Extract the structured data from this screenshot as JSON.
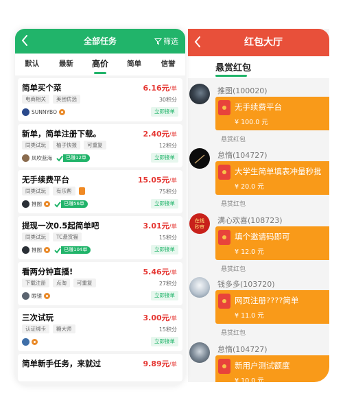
{
  "left_app": {
    "title": "全部任务",
    "filter_label": "筛选",
    "tabs": [
      {
        "label": "默认",
        "active": false
      },
      {
        "label": "最新",
        "active": false
      },
      {
        "label": "高价",
        "active": true
      },
      {
        "label": "简单",
        "active": false
      },
      {
        "label": "信誉",
        "active": false
      }
    ],
    "tasks": [
      {
        "title": "简单买个菜",
        "price": "6.16元",
        "unit": "/单",
        "tags": [
          "电商相关",
          "美团优选"
        ],
        "points": "30积分",
        "user": "SUNNYBO",
        "vip": true,
        "badge": "",
        "join_label": "立即接单"
      },
      {
        "title": "新单，简单注册下载。",
        "price": "2.40元",
        "unit": "/单",
        "tags": [
          "同类试玩",
          "柚子快报",
          "可重复"
        ],
        "points": "12积分",
        "user": "风吹蓝海",
        "vip": false,
        "badge": "已赚12单",
        "join_label": "立即接单"
      },
      {
        "title": "无手续费平台",
        "price": "15.05元",
        "unit": "/单",
        "tags": [
          "同类试玩",
          "有乐帮"
        ],
        "points": "75积分",
        "user": "推图",
        "vip": true,
        "badge": "已赚56单",
        "join_label": "立即接单"
      },
      {
        "title": "提现一次0.5起简单吧",
        "price": "3.01元",
        "unit": "/单",
        "tags": [
          "同类试玩",
          "TC悬赏猫"
        ],
        "points": "15积分",
        "user": "推图",
        "vip": true,
        "badge": "已赚104单",
        "join_label": "立即接单"
      },
      {
        "title": "看两分钟直播!",
        "price": "5.46元",
        "unit": "/单",
        "tags": [
          "下载注册",
          "点淘",
          "可重复"
        ],
        "points": "27积分",
        "user": "眼镜",
        "vip": true,
        "badge": "",
        "join_label": "立即接单"
      },
      {
        "title": "三次试玩",
        "price": "3.00元",
        "unit": "/单",
        "tags": [
          "认证绑卡",
          "糖大师"
        ],
        "points": "15积分",
        "user": "",
        "vip": true,
        "badge": "",
        "join_label": "立即接单"
      },
      {
        "title": "简单新手任务，来就过",
        "price": "9.89元",
        "unit": "/单",
        "tags": [],
        "points": "",
        "user": "",
        "vip": false,
        "badge": "",
        "join_label": ""
      }
    ]
  },
  "right_app": {
    "title": "红包大厅",
    "tab_label": "悬赏红包",
    "posts": [
      {
        "user": "推图(100020)",
        "title": "无手续费平台",
        "amount": "¥ 100.0 元",
        "tag": "悬赏红包"
      },
      {
        "user": "怠惰(104727)",
        "title": "大学生简单填表冲量秒批",
        "amount": "¥ 20.0 元",
        "tag": "悬赏红包"
      },
      {
        "user": "满心欢喜(108723)",
        "title": "填个邀请码即可",
        "amount": "¥ 12.0 元",
        "tag": "悬赏红包",
        "avatar_text": "在线\n秒审"
      },
      {
        "user": "钱多多(103720)",
        "title": "网页注册????简单",
        "amount": "¥ 11.0 元",
        "tag": "悬赏红包"
      },
      {
        "user": "怠惰(104727)",
        "title": "新用户测试额度",
        "amount": "¥ 10.0 元",
        "tag": ""
      }
    ]
  },
  "colors": {
    "green": "#21b46a",
    "red_header": "#e8503a",
    "envelope_orange": "#f99a19",
    "price_red": "#e53935"
  },
  "icons": {
    "back": "chevron-left-icon",
    "filter": "funnel-icon",
    "red_envelope": "red-envelope-icon",
    "verified": "check-icon",
    "vip": "vip-medal-icon"
  }
}
